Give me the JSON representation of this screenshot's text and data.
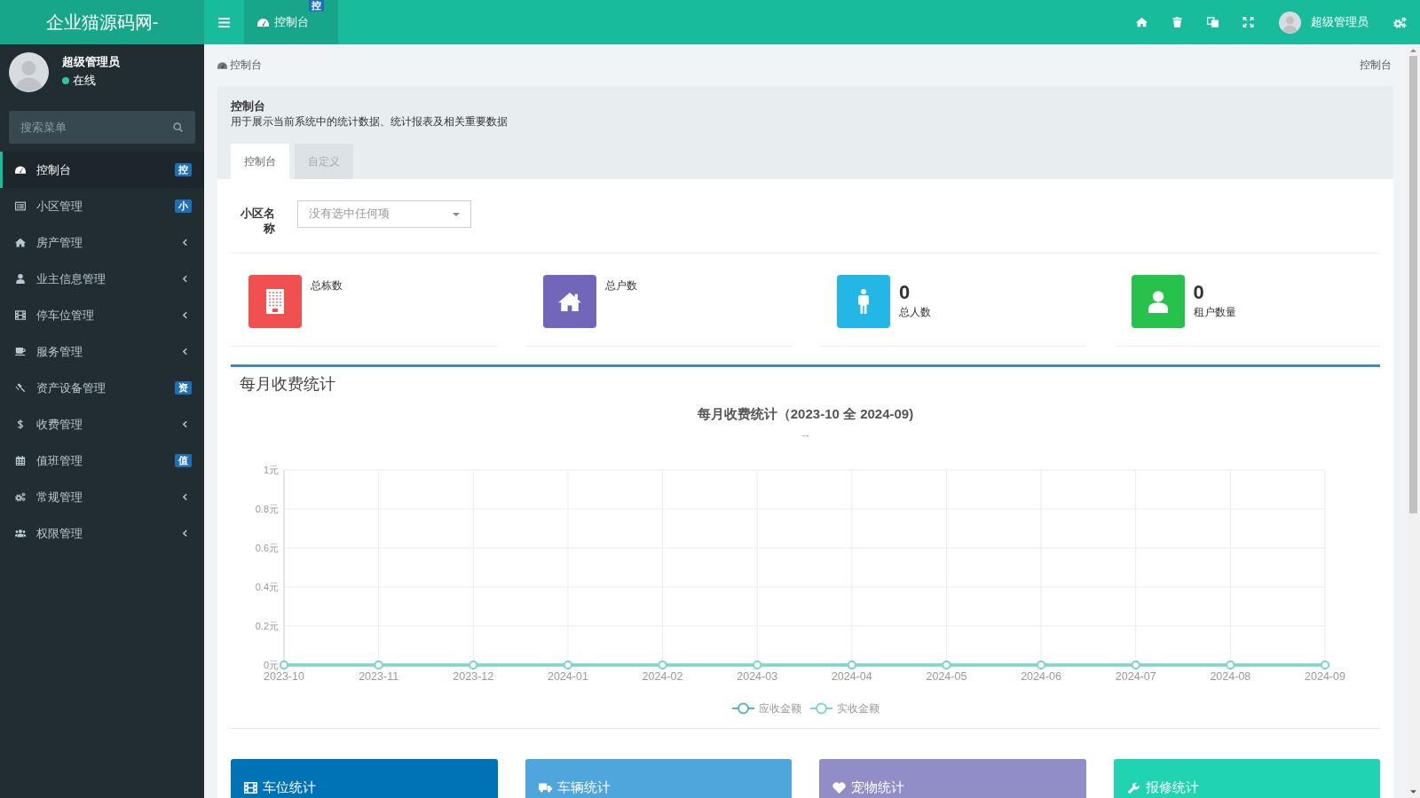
{
  "topbar": {
    "logo": "企业猫源码网-",
    "tabs": [
      {
        "label": "控制台",
        "badge": "控",
        "selected": true
      }
    ],
    "user_name": "超级管理员"
  },
  "sidebar": {
    "user": {
      "name": "超级管理员",
      "status": "在线"
    },
    "search": {
      "placeholder": "搜索菜单"
    },
    "items": [
      {
        "label": "控制台",
        "badge": "控",
        "selected": true
      },
      {
        "label": "小区管理",
        "badge": "小",
        "selected": false
      },
      {
        "label": "房产管理",
        "expanded": false,
        "selected": false
      },
      {
        "label": "业主信息管理",
        "expanded": false,
        "selected": false
      },
      {
        "label": "停车位管理",
        "expanded": false,
        "selected": false
      },
      {
        "label": "服务管理",
        "expanded": false,
        "selected": false
      },
      {
        "label": "资产设备管理",
        "badge": "资",
        "selected": false
      },
      {
        "label": "收费管理",
        "expanded": false,
        "selected": false
      },
      {
        "label": "值班管理",
        "badge": "值",
        "selected": false
      },
      {
        "label": "常规管理",
        "expanded": false,
        "selected": false
      },
      {
        "label": "权限管理",
        "expanded": false,
        "selected": false
      }
    ]
  },
  "breadcrumb": {
    "items": [
      "控制台"
    ],
    "current": "控制台"
  },
  "panel": {
    "title": "控制台",
    "description": "用于展示当前系统中的统计数据、统计报表及相关重要数据",
    "tabs": [
      {
        "label": "控制台",
        "selected": true
      },
      {
        "label": "自定义",
        "selected": false
      }
    ]
  },
  "filter": {
    "label": "小区名称",
    "placeholder": "没有选中任何项"
  },
  "stats": [
    {
      "label": "总栋数",
      "color": "#f05050"
    },
    {
      "label": "总户数",
      "color": "#7266ba"
    },
    {
      "value": "0",
      "label": "总人数",
      "color": "#23b7e5"
    },
    {
      "value": "0",
      "label": "租户数量",
      "color": "#27c24c"
    }
  ],
  "revenue": {
    "title": "每月收费统计",
    "subtitle": "--",
    "chart_data": {
      "type": "line",
      "title": "每月收费统计（2023-10 全 2024-09)",
      "categories": [
        "2023-10",
        "2023-11",
        "2023-12",
        "2024-01",
        "2024-02",
        "2024-03",
        "2024-04",
        "2024-05",
        "2024-06",
        "2024-07",
        "2024-08",
        "2024-09"
      ],
      "series": [
        {
          "name": "应收金额",
          "color": "#5fb1c9",
          "marker": "circle",
          "values": [
            0,
            0,
            0,
            0,
            0,
            0,
            0,
            0,
            0,
            0,
            0,
            0
          ]
        },
        {
          "name": "实收金额",
          "color": "#7fd9c2",
          "marker": "circle",
          "values": [
            0,
            0,
            0,
            0,
            0,
            0,
            0,
            0,
            0,
            0,
            0,
            0
          ]
        }
      ],
      "ylim": [
        0,
        1
      ],
      "yticks": [
        {
          "value": 0,
          "label": "0元"
        },
        {
          "value": 0.2,
          "label": "0.2元"
        },
        {
          "value": 0.4,
          "label": "0.4元"
        },
        {
          "value": 0.6,
          "label": "0.6元"
        },
        {
          "value": 0.8,
          "label": "0.8元"
        },
        {
          "value": 1,
          "label": "1元"
        }
      ],
      "grid": true,
      "legend": true
    }
  },
  "cards": [
    {
      "title": "车位统计",
      "color": "#0073b7"
    },
    {
      "title": "车辆统计",
      "color": "#4fa6dd"
    },
    {
      "title": "宠物统计",
      "color": "#918dc6"
    },
    {
      "title": "报修统计",
      "color": "#20d3b1"
    }
  ]
}
